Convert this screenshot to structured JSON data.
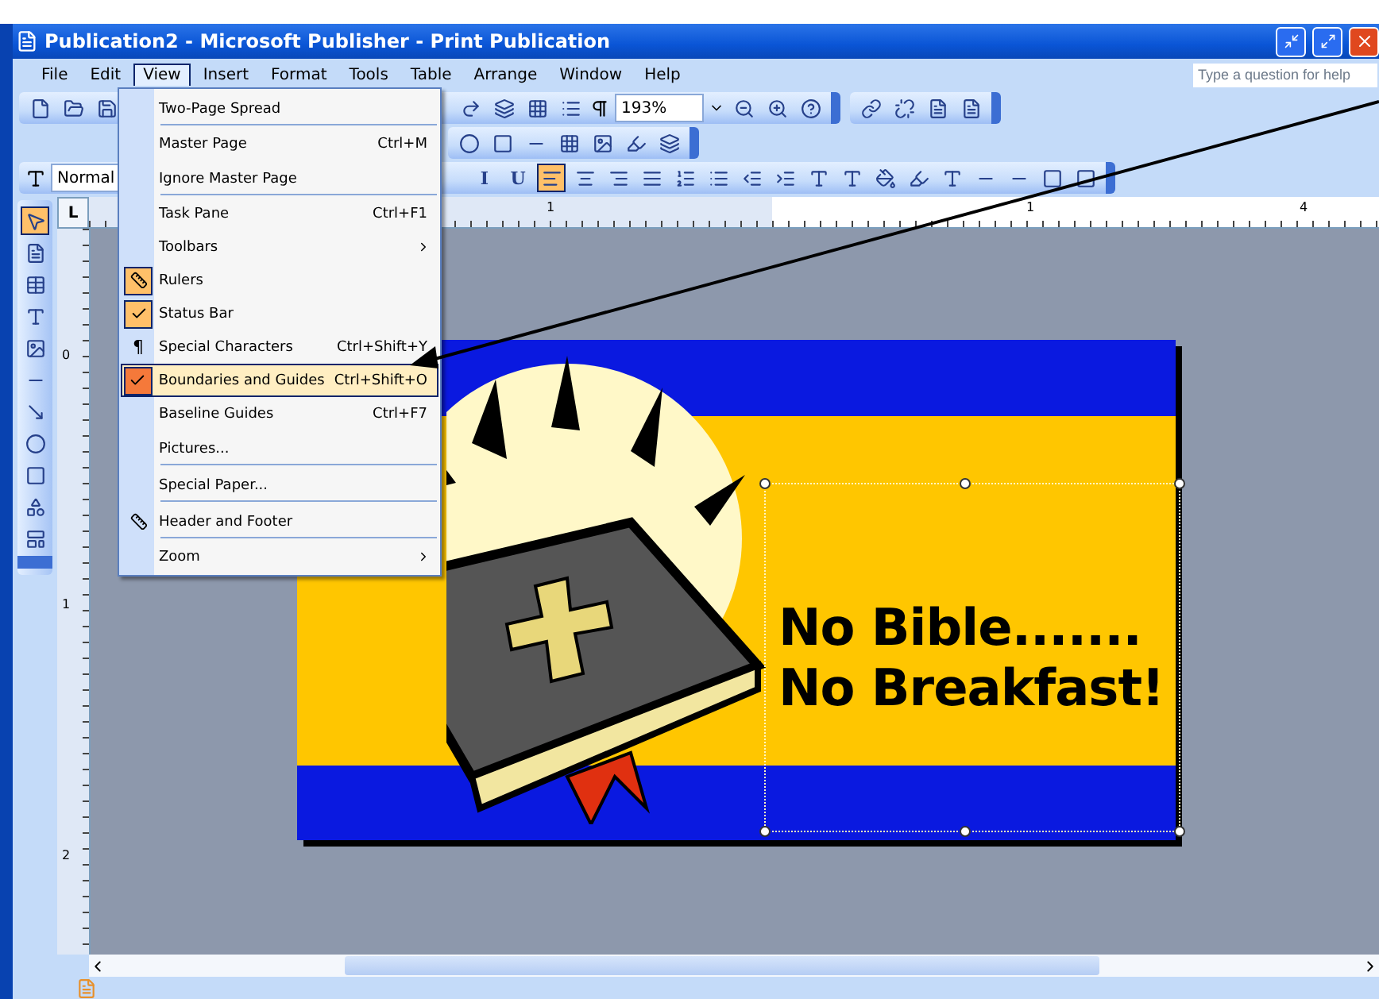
{
  "window": {
    "title": "Publication2 - Microsoft Publisher - Print Publication"
  },
  "menu_bar": [
    {
      "label": "File",
      "selected": false
    },
    {
      "label": "Edit",
      "selected": false
    },
    {
      "label": "View",
      "selected": true
    },
    {
      "label": "Insert",
      "selected": false
    },
    {
      "label": "Format",
      "selected": false
    },
    {
      "label": "Tools",
      "selected": false
    },
    {
      "label": "Table",
      "selected": false
    },
    {
      "label": "Arrange",
      "selected": false
    },
    {
      "label": "Window",
      "selected": false
    },
    {
      "label": "Help",
      "selected": false
    }
  ],
  "help_box": {
    "placeholder": "Type a question for help"
  },
  "standard_toolbar": {
    "zoom": "193%"
  },
  "format_toolbar": {
    "style": "Normal",
    "buttons": [
      {
        "kind": "letter",
        "label": "I",
        "selected": false
      },
      {
        "kind": "letter",
        "label": "U",
        "selected": false
      },
      {
        "kind": "align-left",
        "selected": true
      },
      {
        "kind": "align-center",
        "selected": false
      },
      {
        "kind": "align-right",
        "selected": false
      },
      {
        "kind": "align-justify",
        "selected": false
      }
    ]
  },
  "view_menu": [
    {
      "label": "Two-Page Spread",
      "kind": "plain",
      "checked": false,
      "selected": false,
      "submenu": false,
      "separator_after": true
    },
    {
      "label": "Master Page",
      "shortcut": "Ctrl+M",
      "kind": "plain",
      "checked": false,
      "selected": false,
      "submenu": false,
      "separator_after": false
    },
    {
      "label": "Ignore Master Page",
      "kind": "plain",
      "checked": false,
      "selected": false,
      "submenu": false,
      "separator_after": true
    },
    {
      "label": "Task Pane",
      "shortcut": "Ctrl+F1",
      "kind": "plain",
      "checked": false,
      "selected": false,
      "submenu": false,
      "separator_after": false
    },
    {
      "label": "Toolbars",
      "kind": "plain",
      "checked": false,
      "selected": false,
      "submenu": true,
      "separator_after": false
    },
    {
      "label": "Rulers",
      "kind": "icon",
      "checked": true,
      "selected": false,
      "submenu": false,
      "separator_after": false
    },
    {
      "label": "Status Bar",
      "kind": "check",
      "checked": true,
      "selected": false,
      "submenu": false,
      "separator_after": false
    },
    {
      "label": "Special Characters",
      "shortcut": "Ctrl+Shift+Y",
      "kind": "glyph",
      "glyph": "¶",
      "checked": false,
      "selected": false,
      "submenu": false,
      "separator_after": false
    },
    {
      "label": "Boundaries and Guides",
      "shortcut": "Ctrl+Shift+O",
      "kind": "check",
      "checked": true,
      "selected": true,
      "submenu": false,
      "separator_after": false
    },
    {
      "label": "Baseline Guides",
      "shortcut": "Ctrl+F7",
      "kind": "plain",
      "checked": false,
      "selected": false,
      "submenu": false,
      "separator_after": false
    },
    {
      "label": "Pictures...",
      "kind": "plain",
      "checked": false,
      "selected": false,
      "submenu": false,
      "separator_after": true
    },
    {
      "label": "Special Paper...",
      "kind": "plain",
      "checked": false,
      "selected": false,
      "submenu": false,
      "separator_after": true
    },
    {
      "label": "Header and Footer",
      "kind": "icon",
      "checked": false,
      "selected": false,
      "submenu": false,
      "separator_after": true
    },
    {
      "label": "Zoom",
      "kind": "plain",
      "checked": false,
      "selected": false,
      "submenu": true,
      "separator_after": false
    }
  ],
  "drawing_tools": [
    {
      "kind": "pointer",
      "selected": true
    },
    {
      "kind": "text-box",
      "selected": false
    },
    {
      "kind": "table",
      "selected": false
    },
    {
      "kind": "wordart",
      "selected": false
    },
    {
      "kind": "picture",
      "selected": false
    },
    {
      "kind": "line",
      "selected": false
    },
    {
      "kind": "arrow",
      "selected": false
    },
    {
      "kind": "oval",
      "selected": false
    },
    {
      "kind": "rectangle",
      "selected": false
    },
    {
      "kind": "shapes",
      "selected": false
    },
    {
      "kind": "gallery",
      "selected": false
    }
  ],
  "corner_tab": "L",
  "horizontal_ruler": [
    "1",
    "1",
    "4"
  ],
  "vertical_ruler": [
    "0",
    "1",
    "2"
  ],
  "publication": {
    "lines": [
      "No Bible.......",
      "No Breakfast!"
    ]
  }
}
